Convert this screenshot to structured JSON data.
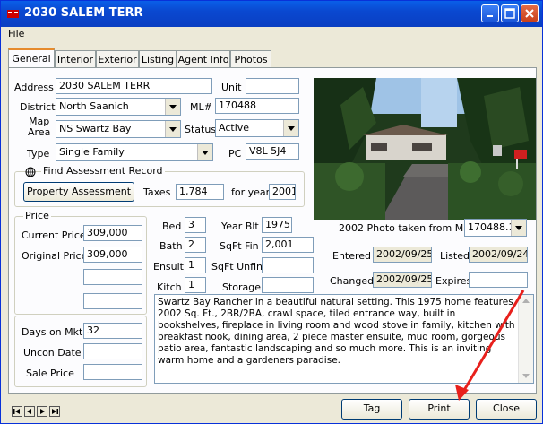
{
  "window": {
    "title": "2030 SALEM TERR"
  },
  "menu": {
    "file": "File"
  },
  "tabs": [
    {
      "label": "General"
    },
    {
      "label": "Interior"
    },
    {
      "label": "Exterior"
    },
    {
      "label": "Listing"
    },
    {
      "label": "Agent Info"
    },
    {
      "label": "Photos"
    }
  ],
  "general": {
    "address_label": "Address",
    "address": "2030 SALEM TERR",
    "unit_label": "Unit",
    "unit": "",
    "district_label": "District",
    "district": "North Saanich",
    "ml_label": "ML#",
    "ml": "170488",
    "map_area_label": "Map Area",
    "map_area": "NS Swartz Bay",
    "status_label": "Status",
    "status": "Active",
    "type_label": "Type",
    "type": "Single Family",
    "pc_label": "PC",
    "pc": "V8L 5J4"
  },
  "assessment": {
    "group_title": "Find Assessment Record",
    "button": "Property Assessment",
    "taxes_label": "Taxes",
    "taxes": "1,784",
    "year_label": "for year",
    "year": "2001"
  },
  "price": {
    "group_title": "Price",
    "current_label": "Current Price",
    "current": "309,000",
    "original_label": "Original Price",
    "original": "309,000"
  },
  "market": {
    "days_label": "Days on Mkt",
    "days": "32",
    "uncon_label": "Uncon Date",
    "uncon": "",
    "sale_label": "Sale Price",
    "sale": ""
  },
  "rooms": {
    "bed_label": "Bed",
    "bed": "3",
    "bath_label": "Bath",
    "bath": "2",
    "ensuit_label": "Ensuit",
    "ensuit": "1",
    "kitch_label": "Kitch",
    "kitch": "1"
  },
  "details": {
    "yearblt_label": "Year Blt",
    "yearblt": "1975",
    "sqftfin_label": "SqFt Fin",
    "sqftfin": "2,001",
    "sqftunfin_label": "SqFt Unfin",
    "sqftunfin": "",
    "storage_label": "Storage",
    "storage": ""
  },
  "photo": {
    "caption": "2002 Photo taken from ML#",
    "ml_select": "170488.1"
  },
  "dates": {
    "entered_label": "Entered",
    "entered": "2002/09/25",
    "listed_label": "Listed",
    "listed": "2002/09/24",
    "changed_label": "Changed",
    "changed": "2002/09/25",
    "expires_label": "Expires",
    "expires": ""
  },
  "remarks": "Swartz Bay Rancher in a beautiful natural setting.  This 1975 home features 2002 Sq. Ft., 2BR/2BA, crawl space, tiled entrance way, built in bookshelves, fireplace in living room and wood stove in family, kitchen with breakfast nook, dining area, 2 piece master ensuite, mud room, gorgeous patio area, fantastic landscaping and so much more.  This is an inviting warm home and a gardeners paradise.",
  "footer": {
    "tag": "Tag",
    "print": "Print",
    "close": "Close"
  },
  "colors": {
    "titlebar": "#0a48d0",
    "annotation_arrow": "#e8201c"
  }
}
